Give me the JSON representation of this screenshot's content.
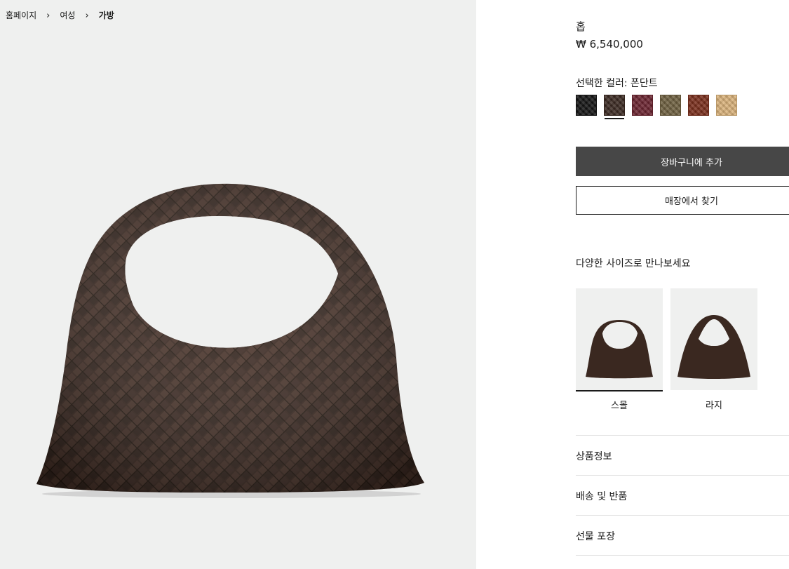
{
  "breadcrumb": {
    "home": "홈페이지",
    "women": "여성",
    "bags": "가방"
  },
  "product": {
    "name": "홉",
    "price": "₩ 6,540,000"
  },
  "color": {
    "label": "선택한 컬러: 폰단트",
    "swatches": [
      {
        "color": "#141414",
        "selected": false
      },
      {
        "color": "#3b2a22",
        "selected": true
      },
      {
        "color": "#6b2430",
        "selected": false
      },
      {
        "color": "#6e6040",
        "selected": false
      },
      {
        "color": "#7a2e1c",
        "selected": false
      },
      {
        "color": "#d9b27a",
        "selected": false
      }
    ]
  },
  "buttons": {
    "add_to_cart": "장바구니에 추가",
    "find_in_store": "매장에서 찾기"
  },
  "sizes": {
    "heading": "다양한 사이즈로 만나보세요",
    "options": [
      {
        "label": "스몰",
        "selected": true
      },
      {
        "label": "라지",
        "selected": false
      }
    ]
  },
  "accordion": [
    {
      "label": "상품정보"
    },
    {
      "label": "배송 및 반품"
    },
    {
      "label": "선물 포장"
    }
  ],
  "colors": {
    "bag_leather": "#3a2820",
    "gallery_bg": "#eff0ef",
    "cart_button": "#474747"
  }
}
